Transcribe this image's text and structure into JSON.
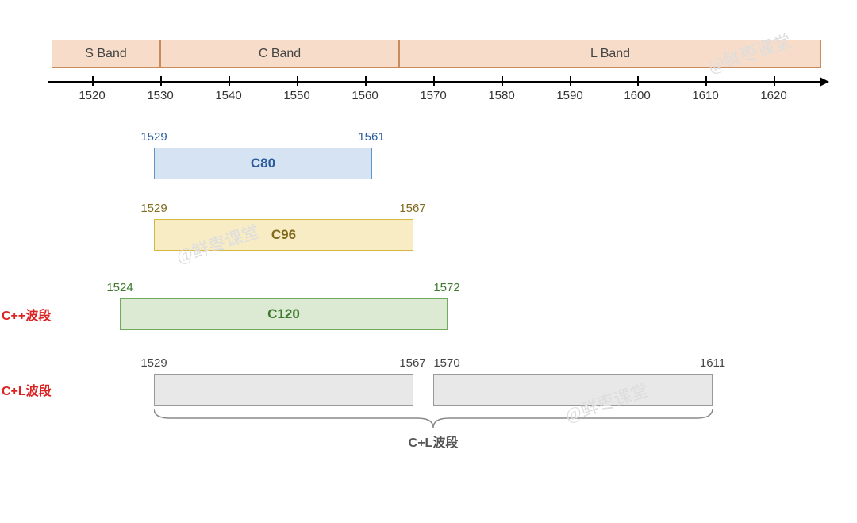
{
  "chart_data": {
    "type": "range",
    "axis_range": [
      1514,
      1627
    ],
    "ticks": [
      1520,
      1530,
      1540,
      1550,
      1560,
      1570,
      1580,
      1590,
      1600,
      1610,
      1620
    ],
    "bands": [
      {
        "name": "S Band",
        "start": 1514,
        "end": 1530
      },
      {
        "name": "C Band",
        "start": 1530,
        "end": 1565
      },
      {
        "name": "L Band",
        "start": 1565,
        "end": 1627
      }
    ],
    "ranges": [
      {
        "name": "C80",
        "start": 1529,
        "end": 1561,
        "group": "c80"
      },
      {
        "name": "C96",
        "start": 1529,
        "end": 1567,
        "group": "c96"
      },
      {
        "name": "C120",
        "start": 1524,
        "end": 1572,
        "group": "c120",
        "side_label": "C++波段"
      },
      {
        "name": "",
        "start": 1529,
        "end": 1567,
        "group": "cl1",
        "side_label": "C+L波段"
      },
      {
        "name": "",
        "start": 1570,
        "end": 1611,
        "group": "cl2"
      }
    ],
    "brace_label": "C+L波段"
  },
  "bands": {
    "s": "S Band",
    "c": "C Band",
    "l": "L Band"
  },
  "ticks": {
    "t0": "1520",
    "t1": "1530",
    "t2": "1540",
    "t3": "1550",
    "t4": "1560",
    "t5": "1570",
    "t6": "1580",
    "t7": "1590",
    "t8": "1600",
    "t9": "1610",
    "t10": "1620"
  },
  "c80": {
    "start": "1529",
    "end": "1561",
    "name": "C80"
  },
  "c96": {
    "start": "1529",
    "end": "1567",
    "name": "C96"
  },
  "c120": {
    "start": "1524",
    "end": "1572",
    "name": "C120",
    "side": "C++波段"
  },
  "cl": {
    "side": "C+L波段",
    "seg1_start": "1529",
    "seg1_end": "1567",
    "seg2_start": "1570",
    "seg2_end": "1611"
  },
  "brace": {
    "label": "C+L波段"
  },
  "watermark": "@鲜枣课堂"
}
